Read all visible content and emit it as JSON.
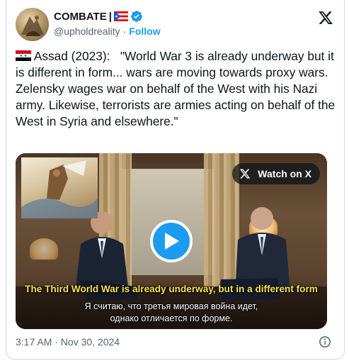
{
  "account": {
    "display_name": "COMBATE",
    "handle": "@upholdreality",
    "separator": "·",
    "follow_label": "Follow"
  },
  "tweet": {
    "flag_label": "Syria flag",
    "text": " Assad (2023):   \"World War 3 is already underway but it is different in form... wars are moving towards proxy wars. Zelensky wages war on behalf of the West with his Nazi army. Likewise, terrorists are armies acting on behalf of the West in Syria and elsewhere.\""
  },
  "media": {
    "watch_label": "Watch on X",
    "caption_en": "The Third World War is already underway, but in a different form",
    "caption_ru_line1": "Я считаю, что третья мировая война идет,",
    "caption_ru_line2": "однако отличается по форме."
  },
  "footer": {
    "timestamp": "3:17 AM · Nov 30, 2024"
  },
  "colors": {
    "accent": "#1d9bf0",
    "text": "#0f1419",
    "muted": "#536471",
    "caption_yellow": "#ffe44d"
  },
  "icons": [
    "avatar",
    "puerto-rico-flag-icon",
    "verified-badge-icon",
    "x-logo-icon",
    "syria-flag-icon",
    "play-icon",
    "info-icon"
  ]
}
